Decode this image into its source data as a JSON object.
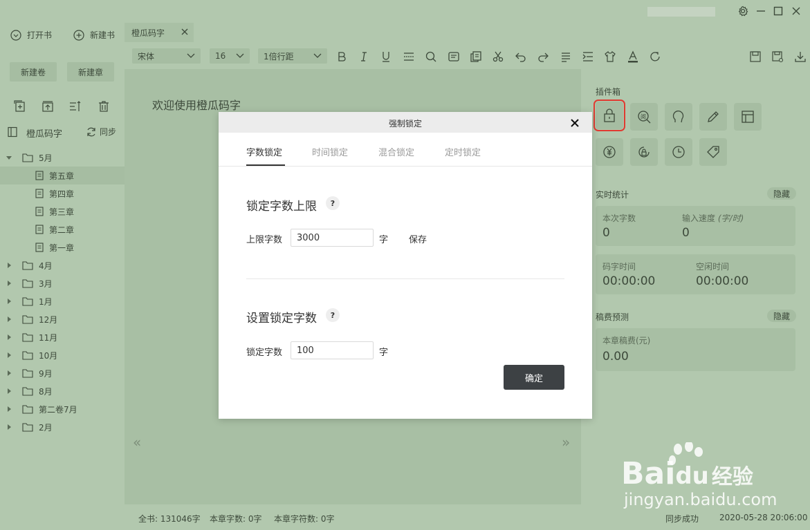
{
  "titlebar": {
    "account_name": "",
    "icons": [
      "gear-icon",
      "minimize-icon",
      "maximize-icon",
      "close-icon"
    ]
  },
  "toolbar_left": {
    "open_book": "打开书",
    "new_book": "新建书",
    "new_volume": "新建卷",
    "new_chapter": "新建章",
    "book_title": "橙瓜码字",
    "sync": "同步"
  },
  "doc_tab": {
    "label": "橙瓜码字"
  },
  "format_bar": {
    "font": "宋体",
    "size": "16",
    "line_spacing": "1倍行距"
  },
  "tree": [
    {
      "label": "5月",
      "expanded": true,
      "type": "folder"
    },
    {
      "label": "第五章",
      "type": "chapter",
      "active": true
    },
    {
      "label": "第四章",
      "type": "chapter"
    },
    {
      "label": "第三章",
      "type": "chapter"
    },
    {
      "label": "第二章",
      "type": "chapter"
    },
    {
      "label": "第一章",
      "type": "chapter"
    },
    {
      "label": "4月",
      "type": "folder"
    },
    {
      "label": "3月",
      "type": "folder"
    },
    {
      "label": "1月",
      "type": "folder"
    },
    {
      "label": "12月",
      "type": "folder"
    },
    {
      "label": "11月",
      "type": "folder"
    },
    {
      "label": "10月",
      "type": "folder"
    },
    {
      "label": "9月",
      "type": "folder"
    },
    {
      "label": "8月",
      "type": "folder"
    },
    {
      "label": "第二卷7月",
      "type": "folder"
    },
    {
      "label": "2月",
      "type": "folder"
    }
  ],
  "editor": {
    "welcome": "欢迎使用橙瓜码字",
    "prev": "«",
    "next": "»"
  },
  "right_panel": {
    "plugins_title": "插件箱",
    "stats_title": "实时统计",
    "hide": "隐藏",
    "this_count_label": "本次字数",
    "this_count": "0",
    "speed_label": "输入速度",
    "speed_unit": "(字/时)",
    "speed": "0",
    "typing_time_label": "码字时间",
    "typing_time": "00:00:00",
    "idle_time_label": "空闲时间",
    "idle_time": "00:00:00",
    "fee_title": "稿费预测",
    "fee_label": "本章稿费(元)",
    "fee": "0.00"
  },
  "statusbar": {
    "total": "全书: 131046字",
    "chapter_words": "本章字数: 0字",
    "chapter_chars": "本章字符数: 0字",
    "sync_status": "同步成功",
    "datetime": "2020-05-28 20:06:00"
  },
  "modal": {
    "title": "强制锁定",
    "tabs": [
      "字数锁定",
      "时间锁定",
      "混合锁定",
      "定时锁定"
    ],
    "active_tab": 0,
    "section1_title": "锁定字数上限",
    "limit_label": "上限字数",
    "limit_value": "3000",
    "unit": "字",
    "save": "保存",
    "section2_title": "设置锁定字数",
    "lock_label": "锁定字数",
    "lock_value": "100",
    "confirm": "确定",
    "help": "?"
  },
  "watermark": {
    "brand": "Bai",
    "brand2": "du",
    "cn": "经验",
    "url": "jingyan.baidu.com"
  }
}
